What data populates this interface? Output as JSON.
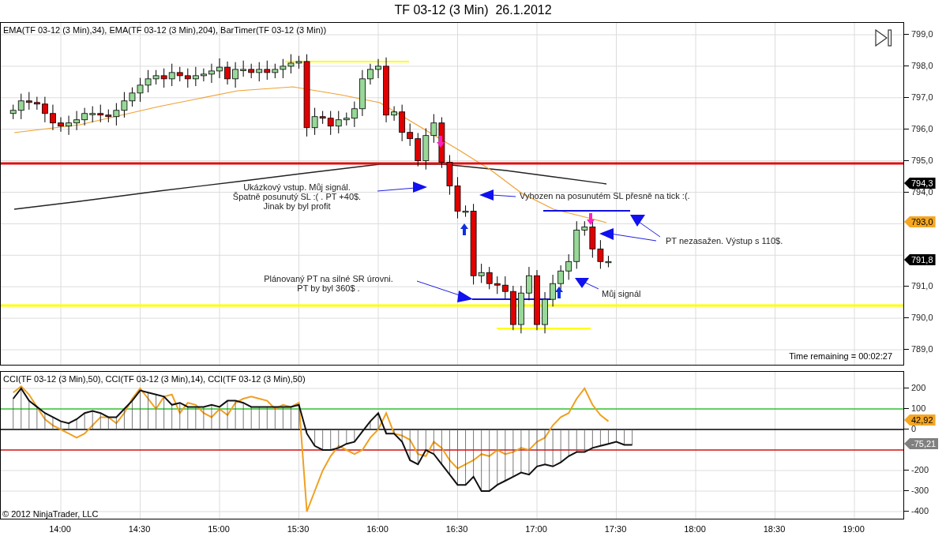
{
  "title": "TF 03-12 (3 Min)  26.1.2012",
  "price_panel": {
    "indicator_label": "EMA(TF 03-12 (3 Min),34), EMA(TF 03-12 (3 Min),204), BarTimer(TF 03-12 (3 Min))",
    "annotations": [
      {
        "lines": [
          "Ukázkový vstup. Můj signál.",
          "Špatně posunutý SL :( . PT +40$.",
          "Jinak by byl profit"
        ]
      },
      {
        "lines": [
          "Vyhozen na posunutém SL přesně na tick :(."
        ]
      },
      {
        "lines": [
          "PT nezasažen. Výstup s 110$."
        ]
      },
      {
        "lines": [
          "Můj signál"
        ]
      },
      {
        "lines": [
          "Plánovaný PT na silné SR úrovni.",
          "PT by byl 360$ ."
        ]
      }
    ],
    "time_remaining": "Time remaining = 00:02:27",
    "ticks": [
      "799,0",
      "798,0",
      "797,0",
      "796,0",
      "795,0",
      "794,0",
      "791,0",
      "790,0",
      "789,0"
    ],
    "badges": [
      {
        "label": "794,3",
        "color": "#000000"
      },
      {
        "label": "793,0",
        "color": "#f5a623"
      },
      {
        "label": "791,8",
        "color": "#000000"
      }
    ]
  },
  "cci_panel": {
    "indicator_label": "CCI(TF 03-12 (3 Min),50), CCI(TF 03-12 (3 Min),14), CCI(TF 03-12 (3 Min),50)",
    "ticks": [
      "200",
      "100",
      "0",
      "-200",
      "-300",
      "-400"
    ],
    "badges": [
      {
        "label": "42,92",
        "color": "#f5a623"
      },
      {
        "label": "-75,21",
        "color": "#808080"
      }
    ]
  },
  "copyright": "© 2012 NinjaTrader, LLC",
  "time_axis": {
    "labels": [
      "14:00",
      "14:30",
      "15:00",
      "15:30",
      "16:00",
      "16:30",
      "17:00",
      "17:30",
      "18:00",
      "18:30",
      "19:00"
    ]
  }
}
